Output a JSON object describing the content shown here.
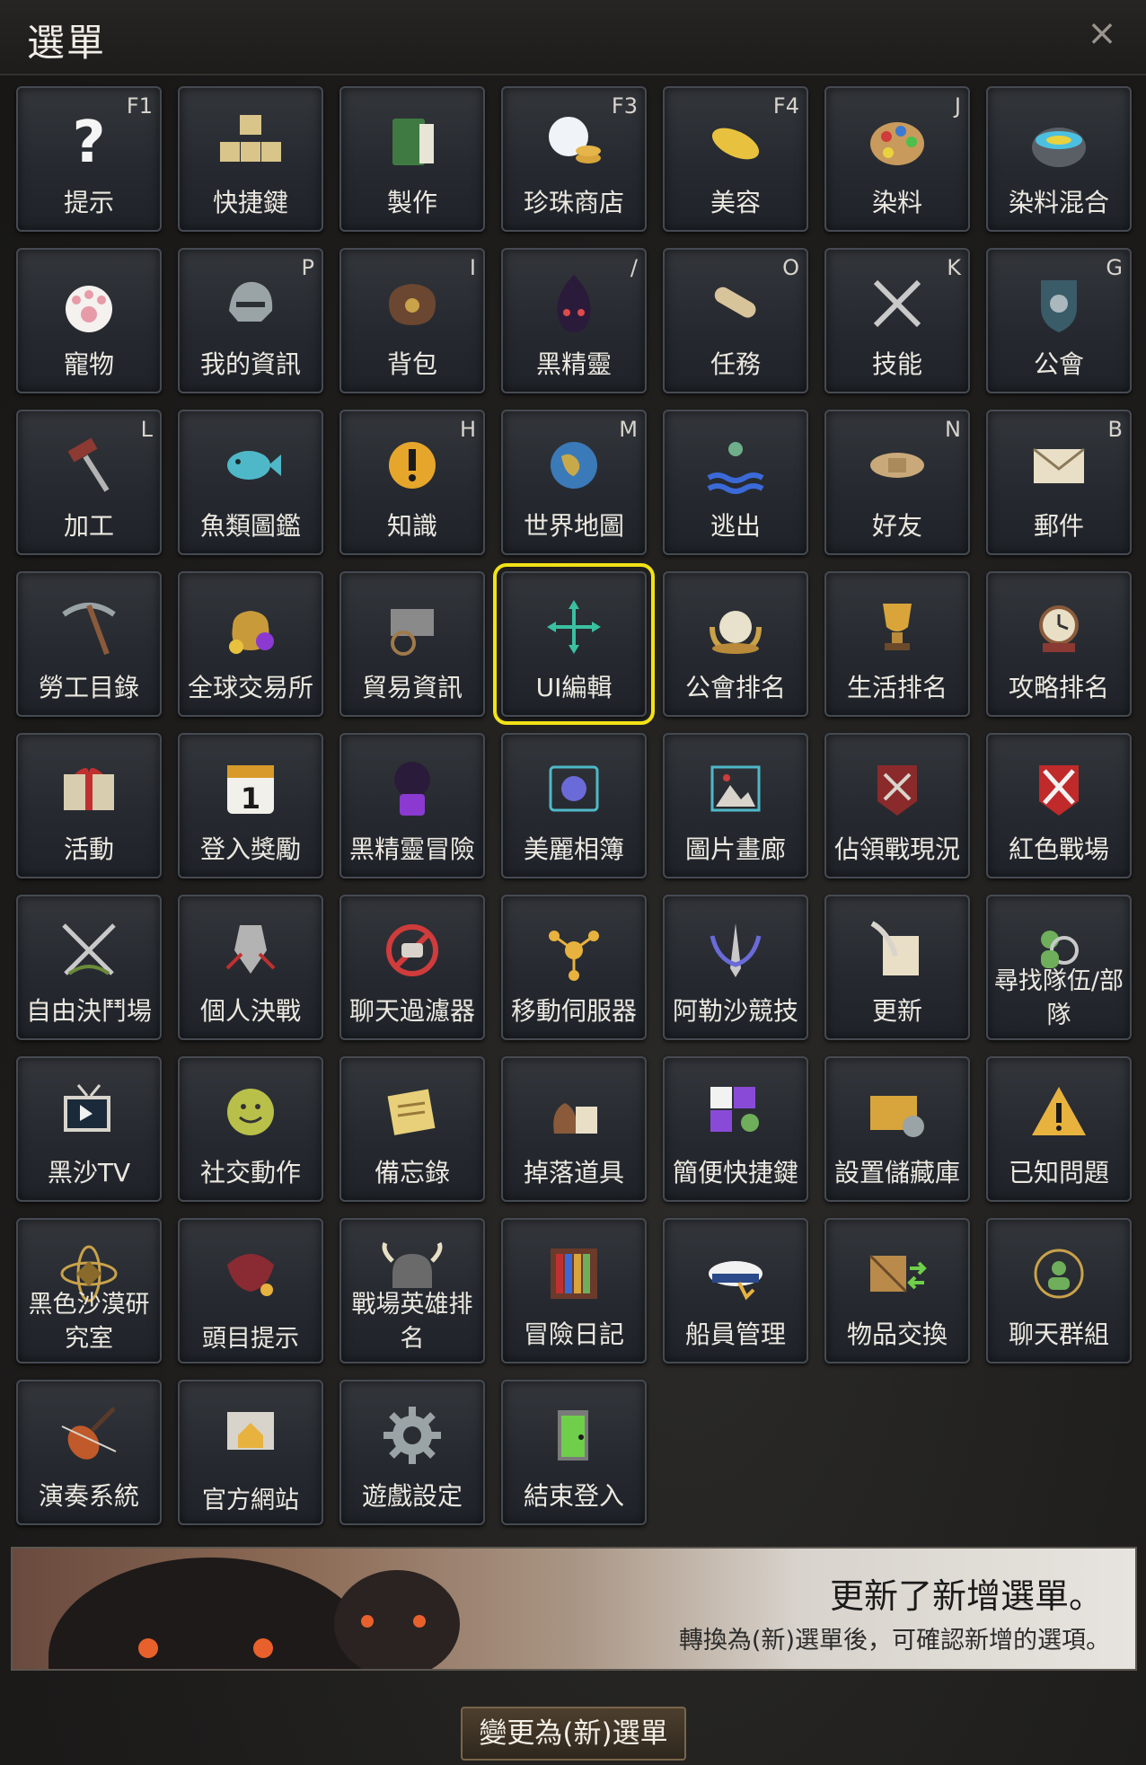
{
  "window": {
    "title": "選單",
    "close_glyph": "×"
  },
  "tiles": [
    {
      "label": "提示",
      "hotkey": "F1",
      "icon": "question-icon"
    },
    {
      "label": "快捷鍵",
      "hotkey": "",
      "icon": "keyboard-icon"
    },
    {
      "label": "製作",
      "hotkey": "",
      "icon": "book-icon"
    },
    {
      "label": "珍珠商店",
      "hotkey": "F3",
      "icon": "pearl-icon"
    },
    {
      "label": "美容",
      "hotkey": "F4",
      "icon": "comb-icon"
    },
    {
      "label": "染料",
      "hotkey": "J",
      "icon": "palette-icon"
    },
    {
      "label": "染料混合",
      "hotkey": "",
      "icon": "dye-pot-icon"
    },
    {
      "label": "寵物",
      "hotkey": "",
      "icon": "paw-icon"
    },
    {
      "label": "我的資訊",
      "hotkey": "P",
      "icon": "helmet-icon"
    },
    {
      "label": "背包",
      "hotkey": "I",
      "icon": "bag-icon"
    },
    {
      "label": "黑精靈",
      "hotkey": "/",
      "icon": "black-spirit-icon"
    },
    {
      "label": "任務",
      "hotkey": "O",
      "icon": "scroll-icon"
    },
    {
      "label": "技能",
      "hotkey": "K",
      "icon": "axes-icon"
    },
    {
      "label": "公會",
      "hotkey": "G",
      "icon": "guild-shield-icon"
    },
    {
      "label": "加工",
      "hotkey": "L",
      "icon": "hammer-icon"
    },
    {
      "label": "魚類圖鑑",
      "hotkey": "",
      "icon": "fish-icon"
    },
    {
      "label": "知識",
      "hotkey": "H",
      "icon": "knowledge-icon"
    },
    {
      "label": "世界地圖",
      "hotkey": "M",
      "icon": "globe-icon"
    },
    {
      "label": "逃出",
      "hotkey": "",
      "icon": "escape-icon"
    },
    {
      "label": "好友",
      "hotkey": "N",
      "icon": "handshake-icon"
    },
    {
      "label": "郵件",
      "hotkey": "B",
      "icon": "mail-icon"
    },
    {
      "label": "勞工目錄",
      "hotkey": "",
      "icon": "pickaxe-icon"
    },
    {
      "label": "全球交易所",
      "hotkey": "",
      "icon": "money-bag-icon"
    },
    {
      "label": "貿易資訊",
      "hotkey": "",
      "icon": "wagon-icon"
    },
    {
      "label": "UI編輯",
      "hotkey": "",
      "icon": "move-icon",
      "selected": true
    },
    {
      "label": "公會排名",
      "hotkey": "",
      "icon": "laurel-crown-icon"
    },
    {
      "label": "生活排名",
      "hotkey": "",
      "icon": "trophy-icon"
    },
    {
      "label": "攻略排名",
      "hotkey": "",
      "icon": "clock-trophy-icon"
    },
    {
      "label": "活動",
      "hotkey": "",
      "icon": "gift-icon"
    },
    {
      "label": "登入獎勵",
      "hotkey": "",
      "icon": "calendar-icon"
    },
    {
      "label": "黑精靈冒險",
      "hotkey": "",
      "icon": "dice-spirit-icon"
    },
    {
      "label": "美麗相簿",
      "hotkey": "",
      "icon": "camera-icon"
    },
    {
      "label": "圖片畫廊",
      "hotkey": "",
      "icon": "picture-icon"
    },
    {
      "label": "佔領戰現況",
      "hotkey": "",
      "icon": "siege-banner-icon"
    },
    {
      "label": "紅色戰場",
      "hotkey": "",
      "icon": "red-battlefield-icon"
    },
    {
      "label": "自由決鬥場",
      "hotkey": "",
      "icon": "crossed-swords-icon"
    },
    {
      "label": "個人決戰",
      "hotkey": "",
      "icon": "warrior-icon"
    },
    {
      "label": "聊天過濾器",
      "hotkey": "",
      "icon": "chat-filter-icon"
    },
    {
      "label": "移動伺服器",
      "hotkey": "",
      "icon": "server-move-icon"
    },
    {
      "label": "阿勒沙競技",
      "hotkey": "",
      "icon": "arena-icon"
    },
    {
      "label": "更新",
      "hotkey": "",
      "icon": "quill-icon"
    },
    {
      "label": "尋找隊伍/部隊",
      "hotkey": "",
      "icon": "party-search-icon",
      "two_line": true
    },
    {
      "label": "黑沙TV",
      "hotkey": "",
      "icon": "tv-icon"
    },
    {
      "label": "社交動作",
      "hotkey": "",
      "icon": "smiley-icon"
    },
    {
      "label": "備忘錄",
      "hotkey": "",
      "icon": "memo-icon"
    },
    {
      "label": "掉落道具",
      "hotkey": "",
      "icon": "loot-icon"
    },
    {
      "label": "簡便快捷鍵",
      "hotkey": "",
      "icon": "quickslot-icon"
    },
    {
      "label": "設置儲藏庫",
      "hotkey": "",
      "icon": "storage-icon"
    },
    {
      "label": "已知問題",
      "hotkey": "",
      "icon": "warning-icon"
    },
    {
      "label": "黑色沙漠研究室",
      "hotkey": "",
      "icon": "atom-icon",
      "two_line": true
    },
    {
      "label": "頭目提示",
      "hotkey": "",
      "icon": "boss-icon",
      "two_line": true
    },
    {
      "label": "戰場英雄排名",
      "hotkey": "",
      "icon": "viking-helmet-icon",
      "two_line": true
    },
    {
      "label": "冒險日記",
      "hotkey": "",
      "icon": "bookshelf-icon"
    },
    {
      "label": "船員管理",
      "hotkey": "",
      "icon": "sailor-hat-icon"
    },
    {
      "label": "物品交換",
      "hotkey": "",
      "icon": "crate-exchange-icon"
    },
    {
      "label": "聊天群組",
      "hotkey": "",
      "icon": "chat-group-icon"
    },
    {
      "label": "演奏系統",
      "hotkey": "",
      "icon": "violin-icon"
    },
    {
      "label": "官方網站",
      "hotkey": "",
      "icon": "home-site-icon",
      "two_line": true
    },
    {
      "label": "遊戲設定",
      "hotkey": "",
      "icon": "gear-icon"
    },
    {
      "label": "結束登入",
      "hotkey": "",
      "icon": "exit-door-icon"
    }
  ],
  "banner": {
    "title": "更新了新增選單。",
    "subtitle": "轉換為(新)選單後，可確認新增的選項。"
  },
  "footer": {
    "button_label": "變更為(新)選單"
  },
  "colors": {
    "selection": "#f3e216",
    "tile_bg": "#2a2e34"
  }
}
